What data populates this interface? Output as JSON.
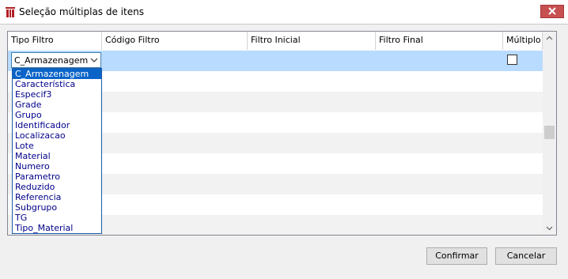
{
  "window": {
    "title": "Seleção múltiplas de itens"
  },
  "icons": {
    "app": "app-logo-icon",
    "close": "close-icon",
    "dropdown": "chevron-down-icon",
    "scroll_up": "chevron-up-icon",
    "scroll_down": "chevron-down-icon"
  },
  "grid": {
    "columns": [
      "Tipo Filtro",
      "Código Filtro",
      "Filtro Inicial",
      "Filtro Final",
      "Múltiplo"
    ],
    "selected_row": {
      "tipo_filtro": "C_Armazenagem",
      "multiplo_checked": false
    }
  },
  "dropdown": {
    "options": [
      "C_Armazenagem",
      "Característica",
      "Especif3",
      "Grade",
      "Grupo",
      "Identificador",
      "Localizacao",
      "Lote",
      "Material",
      "Numero",
      "Parametro",
      "Reduzido",
      "Referencia",
      "Subgrupo",
      "TG",
      "Tipo_Material"
    ],
    "highlighted": "C_Armazenagem"
  },
  "buttons": {
    "confirm": "Confirmar",
    "cancel": "Cancelar"
  },
  "colors": {
    "selection": "#b9dbff",
    "highlight": "#0a64c8",
    "option_text": "#00008b",
    "close": "#c75050"
  }
}
